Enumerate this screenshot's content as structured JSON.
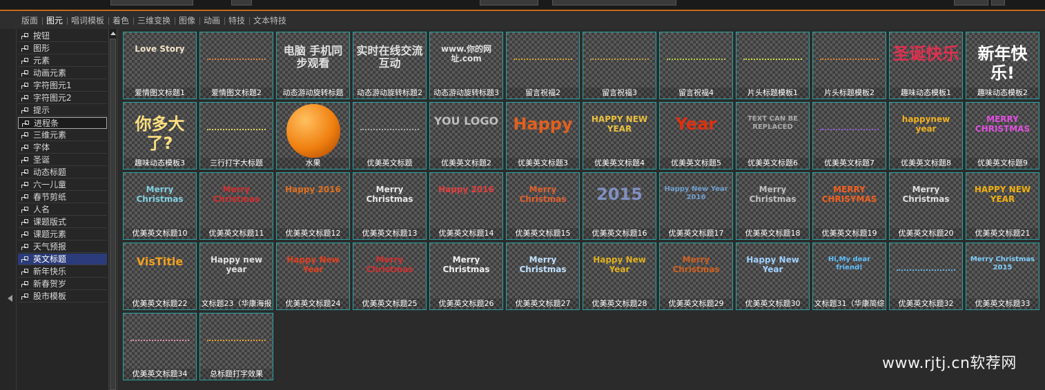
{
  "tabs": [
    "版面",
    "图元",
    "唱词模板",
    "着色",
    "三维变换",
    "图像",
    "动画",
    "特技",
    "文本特技"
  ],
  "active_tab": "图元",
  "tree_items": [
    "按钮",
    "图形",
    "元素",
    "动画元素",
    "字符图元1",
    "字符图元2",
    "提示",
    "进程条",
    "三维元素",
    "字体",
    "圣诞",
    "动态标题",
    "六一儿童",
    "春节剪纸",
    "人名",
    "课题版式",
    "课题元素",
    "天气预报",
    "英文标题",
    "新年快乐",
    "新春贺岁",
    "股市模板"
  ],
  "tree_boxed": "进程条",
  "tree_selected": "英文标题",
  "tiles": [
    {
      "caption": "爱情图文标题1",
      "preview": "Love Story",
      "color": "#f3e2c8"
    },
    {
      "caption": "爱情图文标题2",
      "preview": "",
      "color": "#e08040"
    },
    {
      "caption": "动态游动旋转标题",
      "preview": "电脑 手机同步观看",
      "color": "#e0e0e0"
    },
    {
      "caption": "动态游动旋转标题2",
      "preview": "实时在线交流互动",
      "color": "#e0e0e0"
    },
    {
      "caption": "动态游动旋转标题3",
      "preview": "www.你的网址.com",
      "color": "#e0e0e0"
    },
    {
      "caption": "留言祝福2",
      "preview": "",
      "color": "#d8a030"
    },
    {
      "caption": "留言祝福3",
      "preview": "",
      "color": "#c8a040"
    },
    {
      "caption": "留言祝福4",
      "preview": "",
      "color": "#b8d040"
    },
    {
      "caption": "片头标题模板1",
      "preview": "",
      "color": "#d0e040"
    },
    {
      "caption": "片头标题模板2",
      "preview": "",
      "color": "#e08030"
    },
    {
      "caption": "趣味动态模板1",
      "preview": "圣诞快乐",
      "color": "#e03050"
    },
    {
      "caption": "趣味动态模板2",
      "preview": "新年快乐!",
      "color": "#ffffff"
    },
    {
      "caption": "趣味动态模板3",
      "preview": "你多大了?",
      "color": "#ffe080"
    },
    {
      "caption": "三行打字大标题",
      "preview": "",
      "color": "#e0d060"
    },
    {
      "caption": "水果",
      "preview": "",
      "color": "#f08010"
    },
    {
      "caption": "优美英文标题",
      "preview": "",
      "color": "#aaaaaa"
    },
    {
      "caption": "优美英文标题2",
      "preview": "YOU LOGO",
      "color": "#bdbdbd"
    },
    {
      "caption": "优美英文标题3",
      "preview": "Happy",
      "color": "#e06020"
    },
    {
      "caption": "优美英文标题4",
      "preview": "HAPPY NEW YEAR",
      "color": "#e8c040"
    },
    {
      "caption": "优美英文标题5",
      "preview": "Year",
      "color": "#e03010"
    },
    {
      "caption": "优美英文标题6",
      "preview": "TEXT CAN BE REPLACED",
      "color": "#aaaaaa"
    },
    {
      "caption": "优美英文标题7",
      "preview": "",
      "color": "#9060d0"
    },
    {
      "caption": "优美英文标题8",
      "preview": "happynew year",
      "color": "#f0b020"
    },
    {
      "caption": "优美英文标题9",
      "preview": "MERRY CHRISTMAS",
      "color": "#e050e0"
    },
    {
      "caption": "优美英文标题10",
      "preview": "Merry Christmas",
      "color": "#80d0e0"
    },
    {
      "caption": "优美英文标题11",
      "preview": "Merry Christmas",
      "color": "#d03030"
    },
    {
      "caption": "优美英文标题12",
      "preview": "Happy 2016",
      "color": "#e07020"
    },
    {
      "caption": "优美英文标题13",
      "preview": "Merry Christmas",
      "color": "#e8e8e8"
    },
    {
      "caption": "优美英文标题14",
      "preview": "Happy 2016",
      "color": "#e04040"
    },
    {
      "caption": "优美英文标题15",
      "preview": "Merry Christmas",
      "color": "#e06030"
    },
    {
      "caption": "优美英文标题16",
      "preview": "2015",
      "color": "#8090c0"
    },
    {
      "caption": "优美英文标题17",
      "preview": "Happy New Year 2016",
      "color": "#70a0d0"
    },
    {
      "caption": "优美英文标题18",
      "preview": "Merry Christmas",
      "color": "#c0c0c0"
    },
    {
      "caption": "优美英文标题19",
      "preview": "MERRY CHRISYMAS",
      "color": "#f06020"
    },
    {
      "caption": "优美英文标题20",
      "preview": "Merry Christmas",
      "color": "#e0e0e0"
    },
    {
      "caption": "优美英文标题21",
      "preview": "HAPPY NEW YEAR",
      "color": "#f0b010"
    },
    {
      "caption": "优美英文标题22",
      "preview": "VisTitle",
      "color": "#f0a020"
    },
    {
      "caption": "文标题23（华康海报",
      "preview": "Happy new year",
      "color": "#e0e0e0"
    },
    {
      "caption": "优美英文标题24",
      "preview": "Happy New Year",
      "color": "#e04020"
    },
    {
      "caption": "优美英文标题25",
      "preview": "Merry Christmas",
      "color": "#d03030"
    },
    {
      "caption": "优美英文标题26",
      "preview": "Merry Christmas",
      "color": "#f0f0f0"
    },
    {
      "caption": "优美英文标题27",
      "preview": "Merry Christmas",
      "color": "#c0e0ff"
    },
    {
      "caption": "优美英文标题28",
      "preview": "Happy New Year",
      "color": "#e0b020"
    },
    {
      "caption": "优美英文标题29",
      "preview": "Merry Christmas",
      "color": "#d06020"
    },
    {
      "caption": "优美英文标题30",
      "preview": "Happy New Year",
      "color": "#a0d0ff"
    },
    {
      "caption": "文标题31（华康简综",
      "preview": "Hi,My dear friend!",
      "color": "#60c0ff"
    },
    {
      "caption": "优美英文标题32",
      "preview": "",
      "color": "#60b0e0"
    },
    {
      "caption": "优美英文标题33",
      "preview": "Merry Christmas 2015",
      "color": "#80d0ff"
    },
    {
      "caption": "优美英文标题34",
      "preview": "",
      "color": "#e090b0"
    },
    {
      "caption": "总标题打字效果",
      "preview": "",
      "color": "#e0a030"
    }
  ],
  "watermark": "www.rjtj.cn软荐网"
}
